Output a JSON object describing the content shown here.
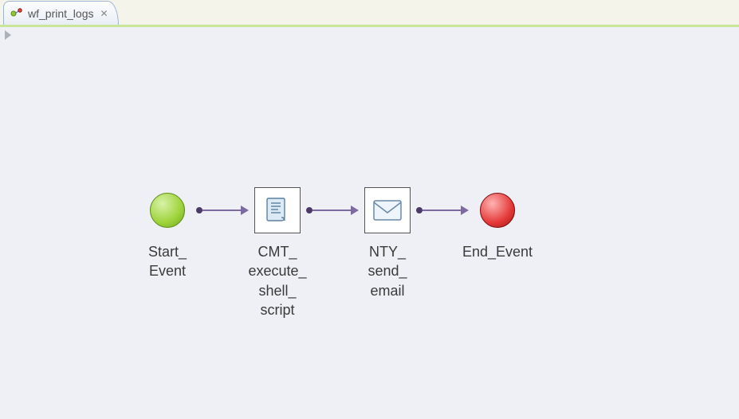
{
  "tab": {
    "title": "wf_print_logs",
    "close_glyph": "✕"
  },
  "workflow": {
    "nodes": [
      {
        "id": "start",
        "kind": "start-event",
        "label": "Start_\nEvent"
      },
      {
        "id": "script",
        "kind": "task-script",
        "label": "CMT_\nexecute_\nshell_\nscript"
      },
      {
        "id": "email",
        "kind": "task-email",
        "label": "NTY_\nsend_\nemail"
      },
      {
        "id": "end",
        "kind": "end-event",
        "label": "End_Event"
      }
    ]
  }
}
